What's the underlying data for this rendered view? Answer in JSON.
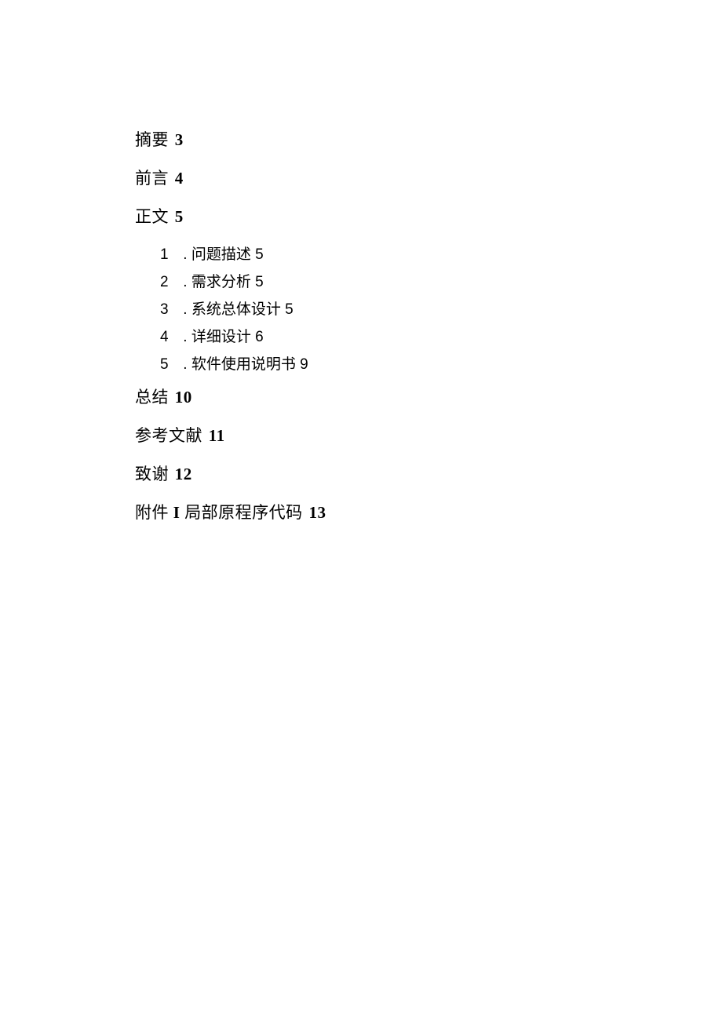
{
  "toc": {
    "main_entries": [
      {
        "label": "摘要",
        "page": "3"
      },
      {
        "label": "前言",
        "page": "4"
      },
      {
        "label": "正文",
        "page": "5"
      }
    ],
    "sub_entries": [
      {
        "num": "1",
        "label": ". 问题描述 5"
      },
      {
        "num": "2",
        "label": ". 需求分析 5"
      },
      {
        "num": "3",
        "label": ". 系统总体设计 5"
      },
      {
        "num": "4",
        "label": ". 详细设计 6"
      },
      {
        "num": "5",
        "label": ". 软件使用说明书 9"
      }
    ],
    "end_entries": [
      {
        "label": "总结",
        "page": "10"
      },
      {
        "label": "参考文献",
        "page": "11"
      },
      {
        "label": "致谢",
        "page": "12"
      }
    ],
    "appendix": {
      "prefix": "附件",
      "roman": "I",
      "label": "局部原程序代码",
      "page": "13"
    }
  }
}
